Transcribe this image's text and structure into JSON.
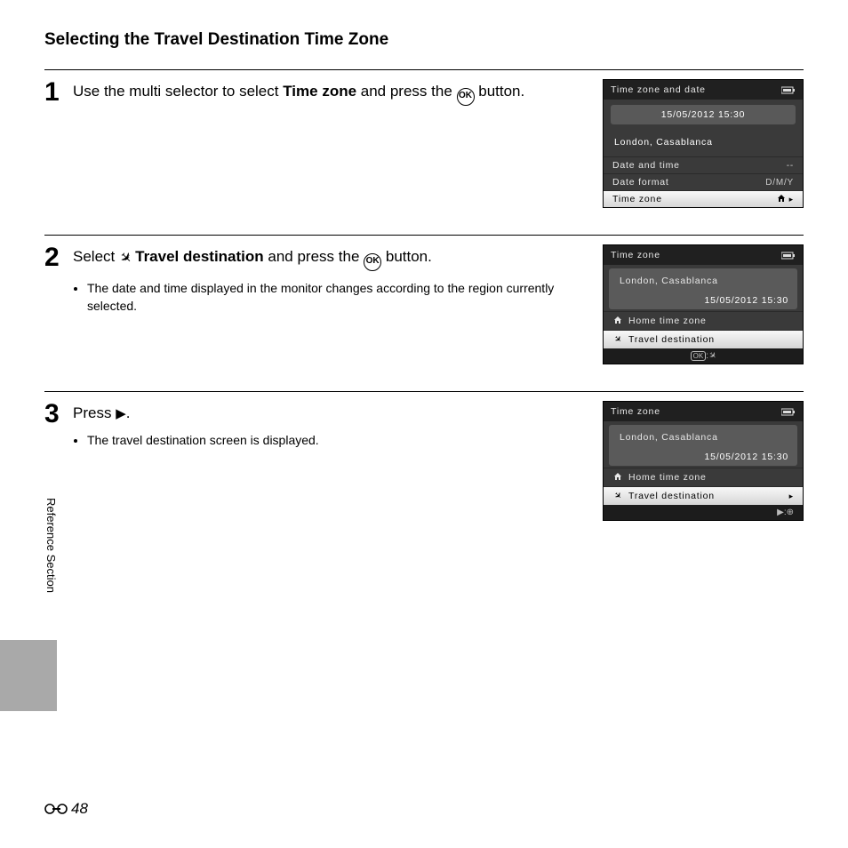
{
  "title": "Selecting the Travel Destination Time Zone",
  "side_section": "Reference Section",
  "page_number": "48",
  "ok_label": "OK",
  "steps": {
    "s1": {
      "num": "1",
      "pre": "Use the multi selector to select ",
      "bold": "Time zone",
      "mid": " and press the ",
      "post": " button."
    },
    "s2": {
      "num": "2",
      "pre": "Select ",
      "bold": "Travel destination",
      "mid": " and press the ",
      "post": " button.",
      "bullet": "The date and time displayed in the monitor changes according to the region currently selected."
    },
    "s3": {
      "num": "3",
      "pre": "Press ",
      "post": ".",
      "bullet": "The travel destination screen is displayed."
    }
  },
  "screens": {
    "a": {
      "header": "Time zone and date",
      "datetime": "15/05/2012 15:30",
      "location": "London, Casablanca",
      "r1_label": "Date and time",
      "r1_val": "--",
      "r2_label": "Date format",
      "r2_val": "D/M/Y",
      "r3_label": "Time zone"
    },
    "b": {
      "header": "Time zone",
      "location": "London, Casablanca",
      "datetime": "15/05/2012 15:30",
      "opt1": "Home time zone",
      "opt2": "Travel destination"
    },
    "c": {
      "header": "Time zone",
      "location": "London, Casablanca",
      "datetime": "15/05/2012 15:30",
      "opt1": "Home time zone",
      "opt2": "Travel destination"
    }
  }
}
